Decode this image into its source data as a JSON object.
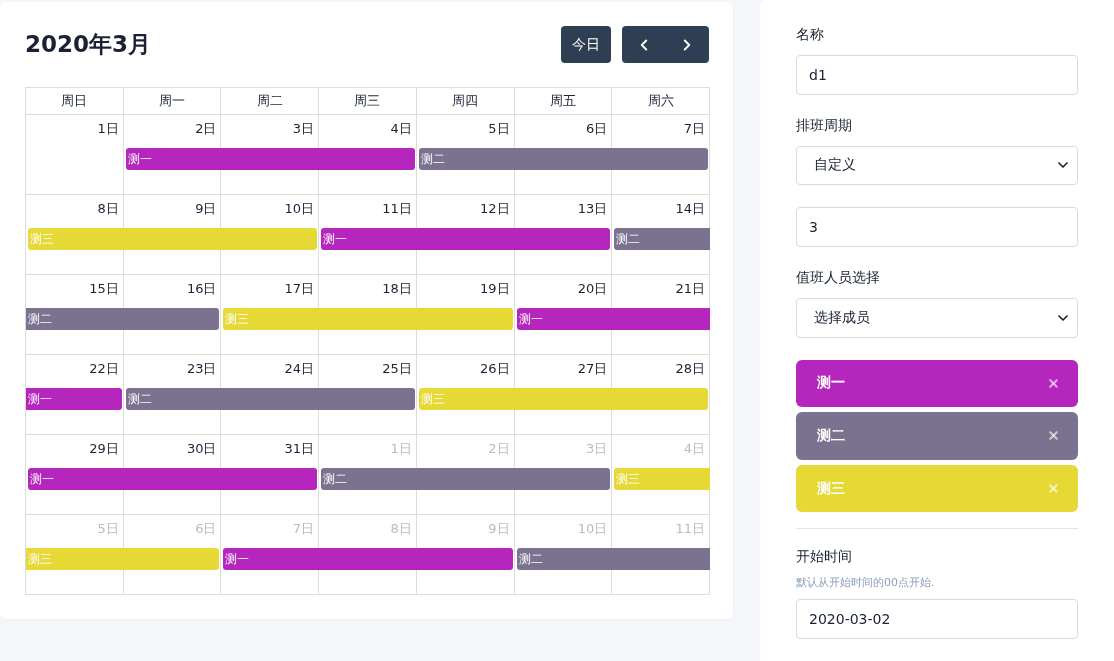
{
  "calendar": {
    "title": "2020年3月",
    "today_button": "今日",
    "weekdays": [
      "周日",
      "周一",
      "周二",
      "周三",
      "周四",
      "周五",
      "周六"
    ],
    "weeks": [
      {
        "days": [
          {
            "label": "1日",
            "other_month": false
          },
          {
            "label": "2日",
            "other_month": false,
            "bar": {
              "label": "测一",
              "color": "#b426bc",
              "starts": true,
              "ends": false
            }
          },
          {
            "label": "3日",
            "other_month": false,
            "bar": {
              "color": "#b426bc",
              "starts": false,
              "ends": false
            }
          },
          {
            "label": "4日",
            "other_month": false,
            "bar": {
              "color": "#b426bc",
              "starts": false,
              "ends": true
            }
          },
          {
            "label": "5日",
            "other_month": false,
            "bar": {
              "label": "测二",
              "color": "#7b728f",
              "starts": true,
              "ends": false
            }
          },
          {
            "label": "6日",
            "other_month": false,
            "bar": {
              "color": "#7b728f",
              "starts": false,
              "ends": false
            }
          },
          {
            "label": "7日",
            "other_month": false,
            "bar": {
              "color": "#7b728f",
              "starts": false,
              "ends": true
            }
          }
        ]
      },
      {
        "days": [
          {
            "label": "8日",
            "other_month": false,
            "bar": {
              "label": "测三",
              "color": "#e6d936",
              "starts": true,
              "ends": false
            }
          },
          {
            "label": "9日",
            "other_month": false,
            "bar": {
              "color": "#e6d936",
              "starts": false,
              "ends": false
            }
          },
          {
            "label": "10日",
            "other_month": false,
            "bar": {
              "color": "#e6d936",
              "starts": false,
              "ends": true
            }
          },
          {
            "label": "11日",
            "other_month": false,
            "bar": {
              "label": "测一",
              "color": "#b426bc",
              "starts": true,
              "ends": false
            }
          },
          {
            "label": "12日",
            "other_month": false,
            "bar": {
              "color": "#b426bc",
              "starts": false,
              "ends": false
            }
          },
          {
            "label": "13日",
            "other_month": false,
            "bar": {
              "color": "#b426bc",
              "starts": false,
              "ends": true
            }
          },
          {
            "label": "14日",
            "other_month": false,
            "bar": {
              "label": "测二",
              "color": "#7b728f",
              "starts": true,
              "ends": false
            }
          }
        ]
      },
      {
        "days": [
          {
            "label": "15日",
            "other_month": false,
            "bar": {
              "label": "测二",
              "color": "#7b728f",
              "starts": false,
              "ends": false
            }
          },
          {
            "label": "16日",
            "other_month": false,
            "bar": {
              "color": "#7b728f",
              "starts": false,
              "ends": true
            }
          },
          {
            "label": "17日",
            "other_month": false,
            "bar": {
              "label": "测三",
              "color": "#e6d936",
              "starts": true,
              "ends": false
            }
          },
          {
            "label": "18日",
            "other_month": false,
            "bar": {
              "color": "#e6d936",
              "starts": false,
              "ends": false
            }
          },
          {
            "label": "19日",
            "other_month": false,
            "bar": {
              "color": "#e6d936",
              "starts": false,
              "ends": true
            }
          },
          {
            "label": "20日",
            "other_month": false,
            "bar": {
              "label": "测一",
              "color": "#b426bc",
              "starts": true,
              "ends": false
            }
          },
          {
            "label": "21日",
            "other_month": false,
            "bar": {
              "color": "#b426bc",
              "starts": false,
              "ends": false
            }
          }
        ]
      },
      {
        "days": [
          {
            "label": "22日",
            "other_month": false,
            "bar": {
              "label": "测一",
              "color": "#b426bc",
              "starts": false,
              "ends": true
            }
          },
          {
            "label": "23日",
            "other_month": false,
            "bar": {
              "label": "测二",
              "color": "#7b728f",
              "starts": true,
              "ends": false
            }
          },
          {
            "label": "24日",
            "other_month": false,
            "bar": {
              "color": "#7b728f",
              "starts": false,
              "ends": false
            }
          },
          {
            "label": "25日",
            "other_month": false,
            "bar": {
              "color": "#7b728f",
              "starts": false,
              "ends": true
            }
          },
          {
            "label": "26日",
            "other_month": false,
            "bar": {
              "label": "测三",
              "color": "#e6d936",
              "starts": true,
              "ends": false
            }
          },
          {
            "label": "27日",
            "other_month": false,
            "bar": {
              "color": "#e6d936",
              "starts": false,
              "ends": false
            }
          },
          {
            "label": "28日",
            "other_month": false,
            "bar": {
              "color": "#e6d936",
              "starts": false,
              "ends": true
            }
          }
        ]
      },
      {
        "days": [
          {
            "label": "29日",
            "other_month": false,
            "bar": {
              "label": "测一",
              "color": "#b426bc",
              "starts": true,
              "ends": false
            }
          },
          {
            "label": "30日",
            "other_month": false,
            "bar": {
              "color": "#b426bc",
              "starts": false,
              "ends": false
            }
          },
          {
            "label": "31日",
            "other_month": false,
            "bar": {
              "color": "#b426bc",
              "starts": false,
              "ends": true
            }
          },
          {
            "label": "1日",
            "other_month": true,
            "bar": {
              "label": "测二",
              "color": "#7b728f",
              "starts": true,
              "ends": false
            }
          },
          {
            "label": "2日",
            "other_month": true,
            "bar": {
              "color": "#7b728f",
              "starts": false,
              "ends": false
            }
          },
          {
            "label": "3日",
            "other_month": true,
            "bar": {
              "color": "#7b728f",
              "starts": false,
              "ends": true
            }
          },
          {
            "label": "4日",
            "other_month": true,
            "bar": {
              "label": "测三",
              "color": "#e6d936",
              "starts": true,
              "ends": false
            }
          }
        ]
      },
      {
        "days": [
          {
            "label": "5日",
            "other_month": true,
            "bar": {
              "label": "测三",
              "color": "#e6d936",
              "starts": false,
              "ends": false
            }
          },
          {
            "label": "6日",
            "other_month": true,
            "bar": {
              "color": "#e6d936",
              "starts": false,
              "ends": true
            }
          },
          {
            "label": "7日",
            "other_month": true,
            "bar": {
              "label": "测一",
              "color": "#b426bc",
              "starts": true,
              "ends": false
            }
          },
          {
            "label": "8日",
            "other_month": true,
            "bar": {
              "color": "#b426bc",
              "starts": false,
              "ends": false
            }
          },
          {
            "label": "9日",
            "other_month": true,
            "bar": {
              "color": "#b426bc",
              "starts": false,
              "ends": true
            }
          },
          {
            "label": "10日",
            "other_month": true,
            "bar": {
              "label": "测二",
              "color": "#7b728f",
              "starts": true,
              "ends": false
            }
          },
          {
            "label": "11日",
            "other_month": true,
            "bar": {
              "color": "#7b728f",
              "starts": false,
              "ends": false
            }
          }
        ]
      }
    ]
  },
  "form": {
    "name": {
      "label": "名称",
      "value": "d1"
    },
    "cycle": {
      "label": "排班周期",
      "value": "自定义"
    },
    "cycle_days": {
      "value": "3"
    },
    "staff": {
      "label": "值班人员选择",
      "value": "选择成员"
    },
    "members": [
      {
        "name": "测一",
        "color": "#b426bc"
      },
      {
        "name": "测二",
        "color": "#7b728f"
      },
      {
        "name": "测三",
        "color": "#e6d936"
      }
    ],
    "start_time": {
      "label": "开始时间",
      "hint": "默认从开始时间的00点开始.",
      "value": "2020-03-02"
    }
  }
}
